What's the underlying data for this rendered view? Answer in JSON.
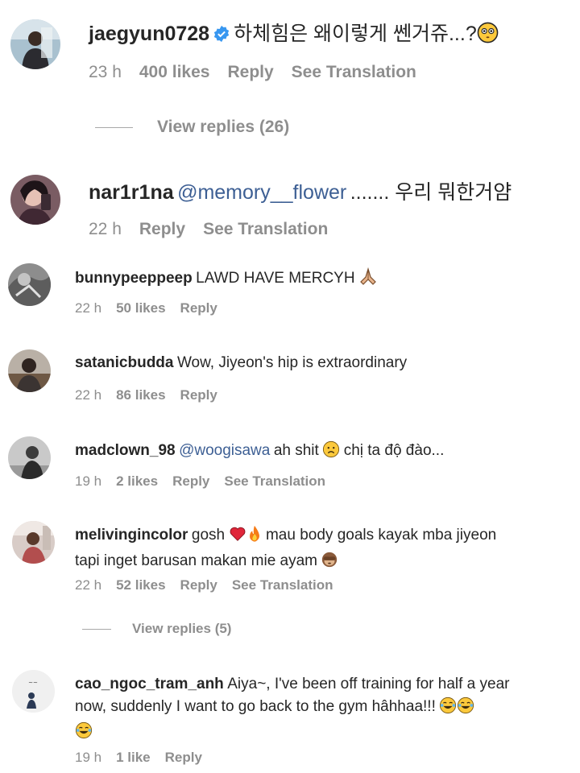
{
  "comments": [
    {
      "username": "jaegyun0728",
      "verified": true,
      "mention": "",
      "text": "하체힘은 왜이렇게 쎈거쥬...?",
      "emoji": "flushed-face",
      "time": "23 h",
      "likes": "400 likes",
      "reply": "Reply",
      "translation": "See Translation",
      "view_replies": "View replies (26)"
    },
    {
      "username": "nar1r1na",
      "verified": false,
      "mention": "@memory__flower",
      "text": "....... 우리 뭐한거얌",
      "time": "22 h",
      "reply": "Reply",
      "translation": "See Translation"
    },
    {
      "username": "bunnypeeppeep",
      "mention": "",
      "text": "LAWD HAVE MERCYH",
      "emoji": "folded-hands",
      "time": "22 h",
      "likes": "50 likes",
      "reply": "Reply"
    },
    {
      "username": "satanicbudda",
      "mention": "",
      "text": "Wow, Jiyeon's hip is extraordinary",
      "time": "22 h",
      "likes": "86 likes",
      "reply": "Reply"
    },
    {
      "username": "madclown_98",
      "mention": "@woogisawa",
      "text_a": "ah shit",
      "emoji": "sad-face",
      "text_b": "chị ta độ đào...",
      "time": "19 h",
      "likes": "2 likes",
      "reply": "Reply",
      "translation": "See Translation"
    },
    {
      "username": "melivingincolor",
      "text_a": "gosh",
      "emoji_a": "red-heart",
      "emoji_b": "fire",
      "text_b": "mau body goals kayak mba jiyeon",
      "text_c": "tapi inget barusan makan mie ayam",
      "emoji_c": "see-no-evil-monkey",
      "time": "22 h",
      "likes": "52 likes",
      "reply": "Reply",
      "translation": "See Translation",
      "view_replies": "View replies (5)"
    },
    {
      "username": "cao_ngoc_tram_anh",
      "text_a": "Aiya~, I've been off training for half a year",
      "text_b": "now, suddenly I want to go back to the gym hâhhaa!!!",
      "emoji": "joy-face",
      "time": "19 h",
      "likes": "1 like",
      "reply": "Reply"
    }
  ],
  "colors": {
    "text": "#262626",
    "meta": "#8e8e8e",
    "mention": "#3d5f94",
    "verified": "#3897f0"
  }
}
